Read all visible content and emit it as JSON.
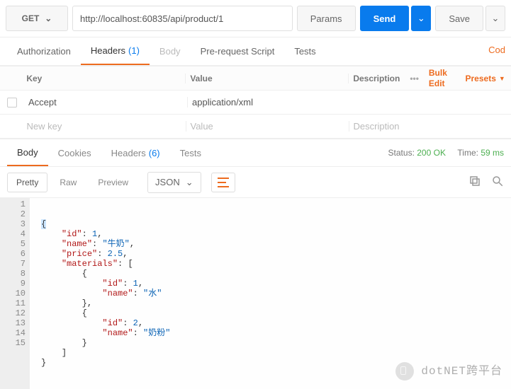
{
  "request": {
    "method": "GET",
    "url": "http://localhost:60835/api/product/1",
    "params_label": "Params",
    "send_label": "Send",
    "save_label": "Save"
  },
  "tabs": {
    "authorization": "Authorization",
    "headers": "Headers",
    "headers_count": "(1)",
    "body": "Body",
    "prerequest": "Pre-request Script",
    "tests": "Tests",
    "code": "Cod"
  },
  "headers_table": {
    "col_key": "Key",
    "col_value": "Value",
    "col_desc": "Description",
    "bulk_edit": "Bulk Edit",
    "presets": "Presets",
    "rows": [
      {
        "key": "Accept",
        "value": "application/xml",
        "desc": ""
      }
    ],
    "new_key_ph": "New key",
    "new_val_ph": "Value",
    "new_desc_ph": "Description"
  },
  "response_tabs": {
    "body": "Body",
    "cookies": "Cookies",
    "headers": "Headers",
    "headers_count": "(6)",
    "tests": "Tests"
  },
  "response_meta": {
    "status_label": "Status:",
    "status_value": "200 OK",
    "time_label": "Time:",
    "time_value": "59 ms"
  },
  "pretty_bar": {
    "pretty": "Pretty",
    "raw": "Raw",
    "preview": "Preview",
    "format": "JSON"
  },
  "chart_data": {
    "type": "json_body",
    "value": {
      "id": 1,
      "name": "牛奶",
      "price": 2.5,
      "materials": [
        {
          "id": 1,
          "name": "水"
        },
        {
          "id": 2,
          "name": "奶粉"
        }
      ]
    },
    "lines": [
      {
        "n": 1,
        "fold": true,
        "text": "{",
        "hl": true
      },
      {
        "n": 2,
        "text": "    \"id\": 1,"
      },
      {
        "n": 3,
        "text": "    \"name\": \"牛奶\","
      },
      {
        "n": 4,
        "text": "    \"price\": 2.5,"
      },
      {
        "n": 5,
        "fold": true,
        "text": "    \"materials\": ["
      },
      {
        "n": 6,
        "fold": true,
        "text": "        {"
      },
      {
        "n": 7,
        "text": "            \"id\": 1,"
      },
      {
        "n": 8,
        "text": "            \"name\": \"水\""
      },
      {
        "n": 9,
        "text": "        },"
      },
      {
        "n": 10,
        "fold": true,
        "text": "        {"
      },
      {
        "n": 11,
        "text": "            \"id\": 2,"
      },
      {
        "n": 12,
        "text": "            \"name\": \"奶粉\""
      },
      {
        "n": 13,
        "text": "        }"
      },
      {
        "n": 14,
        "text": "    ]"
      },
      {
        "n": 15,
        "text": "}"
      }
    ]
  },
  "watermark": "dotNET跨平台"
}
